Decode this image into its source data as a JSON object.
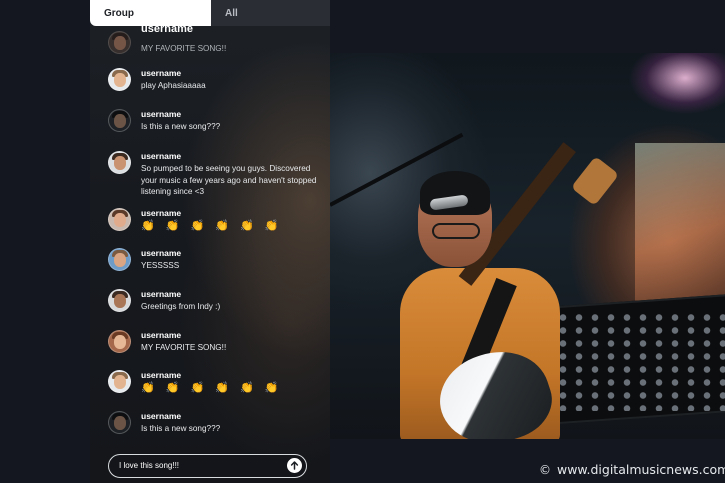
{
  "tabs": {
    "group_label": "Group",
    "all_label": "All"
  },
  "messages": [
    {
      "username": "username",
      "text": "MY FAVORITE SONG!!"
    },
    {
      "username": "username",
      "text": "play Aphasiaaaaa"
    },
    {
      "username": "username",
      "text": "Is this a new song???"
    },
    {
      "username": "username",
      "text": "So pumped to be seeing you guys. Discovered your music a few years ago and haven't stopped listening since <3"
    },
    {
      "username": "username",
      "text": "👏 👏 👏 👏 👏 👏"
    },
    {
      "username": "username",
      "text": "YESSSSS"
    },
    {
      "username": "username",
      "text": "Greetings from Indy :)"
    },
    {
      "username": "username",
      "text": "MY FAVORITE SONG!!"
    },
    {
      "username": "username",
      "text": "👏 👏 👏 👏 👏 👏"
    },
    {
      "username": "username",
      "text": "Is this a new song???"
    }
  ],
  "composer": {
    "value": "I love this song!!!"
  },
  "icons": {
    "send": "arrow-up-icon",
    "avatar": "user-avatar"
  },
  "watermark": {
    "copyright_symbol": "©",
    "site": "www.digitalmusicnews.com"
  },
  "colors": {
    "panel_bg": "#1a1d22",
    "page_bg": "#141720",
    "active_tab_bg": "#ffffff",
    "inactive_tab_bg": "#2a2d33",
    "clap_emoji": "#e8b93a"
  }
}
